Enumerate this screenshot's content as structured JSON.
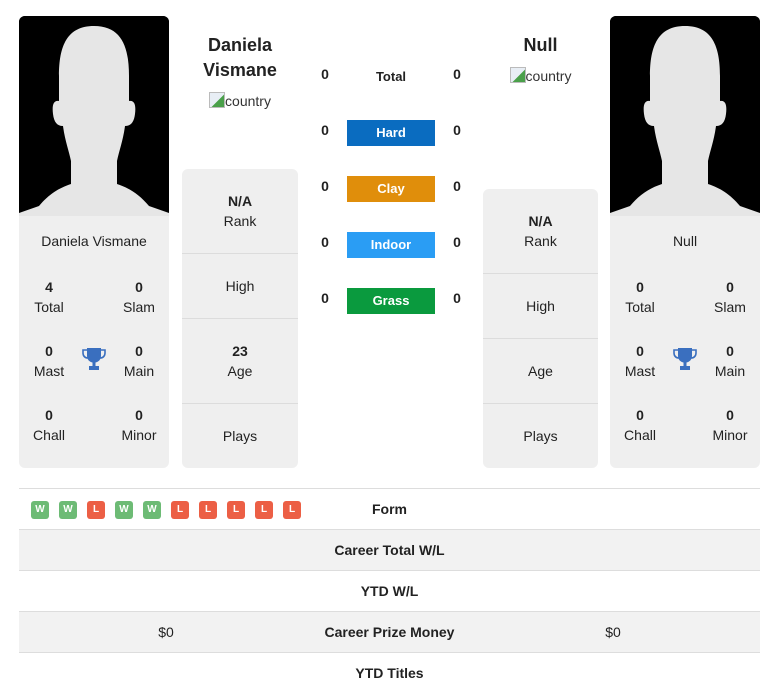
{
  "player1": {
    "name": "Daniela Vismane",
    "title_line1": "Daniela",
    "title_line2": "Vismane",
    "country_alt": "country",
    "stats": {
      "total": {
        "value": "4",
        "label": "Total"
      },
      "slam": {
        "value": "0",
        "label": "Slam"
      },
      "mast": {
        "value": "0",
        "label": "Mast"
      },
      "main": {
        "value": "0",
        "label": "Main"
      },
      "chall": {
        "value": "0",
        "label": "Chall"
      },
      "minor": {
        "value": "0",
        "label": "Minor"
      }
    },
    "rank": {
      "value": "N/A",
      "label": "Rank"
    },
    "high": {
      "value": "",
      "label": "High"
    },
    "age": {
      "value": "23",
      "label": "Age"
    },
    "plays": {
      "value": "",
      "label": "Plays"
    }
  },
  "player2": {
    "name": "Null",
    "title": "Null",
    "country_alt": "country",
    "stats": {
      "total": {
        "value": "0",
        "label": "Total"
      },
      "slam": {
        "value": "0",
        "label": "Slam"
      },
      "mast": {
        "value": "0",
        "label": "Mast"
      },
      "main": {
        "value": "0",
        "label": "Main"
      },
      "chall": {
        "value": "0",
        "label": "Chall"
      },
      "minor": {
        "value": "0",
        "label": "Minor"
      }
    },
    "rank": {
      "value": "N/A",
      "label": "Rank"
    },
    "high": {
      "value": "",
      "label": "High"
    },
    "age": {
      "value": "",
      "label": "Age"
    },
    "plays": {
      "value": "",
      "label": "Plays"
    }
  },
  "h2h": {
    "total": {
      "label": "Total",
      "left": "0",
      "right": "0"
    },
    "surfaces": [
      {
        "label": "Hard",
        "left": "0",
        "right": "0",
        "color": "#0a6cc0"
      },
      {
        "label": "Clay",
        "left": "0",
        "right": "0",
        "color": "#e08e0b"
      },
      {
        "label": "Indoor",
        "left": "0",
        "right": "0",
        "color": "#2a9df4"
      },
      {
        "label": "Grass",
        "left": "0",
        "right": "0",
        "color": "#0a9a3e"
      }
    ]
  },
  "colors": {
    "win": "#6dbb75",
    "loss": "#ec5f45",
    "trophy": "#3a6fbf"
  },
  "table": {
    "form_label": "Form",
    "form": [
      "W",
      "W",
      "L",
      "W",
      "W",
      "L",
      "L",
      "L",
      "L",
      "L"
    ],
    "rows": [
      {
        "label": "Career Total W/L",
        "left": "",
        "right": ""
      },
      {
        "label": "YTD W/L",
        "left": "",
        "right": ""
      },
      {
        "label": "Career Prize Money",
        "left": "$0",
        "right": "$0"
      },
      {
        "label": "YTD Titles",
        "left": "",
        "right": ""
      }
    ]
  }
}
